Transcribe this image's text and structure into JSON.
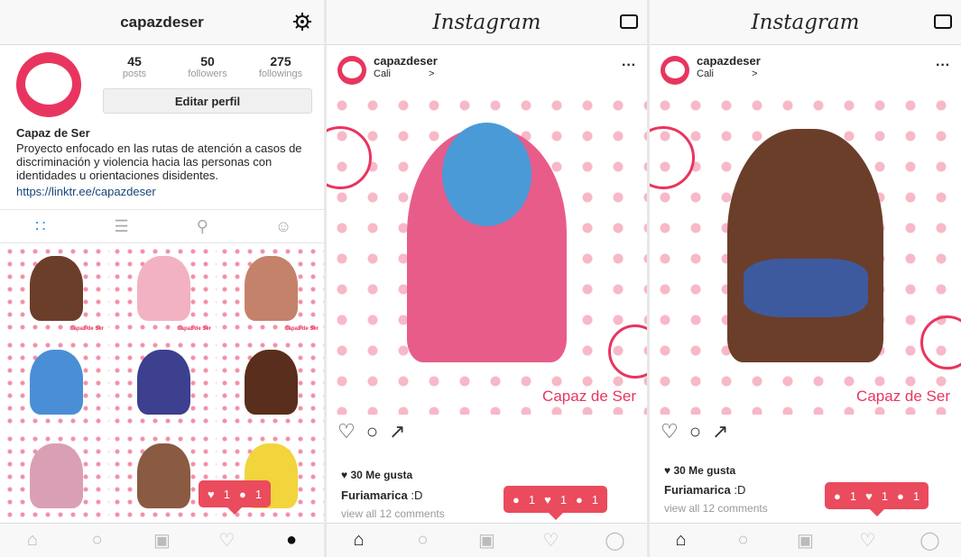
{
  "profile": {
    "username": "capazdeser",
    "posts": {
      "n": "45",
      "label": "posts"
    },
    "followers": {
      "n": "50",
      "label": "followers"
    },
    "followings": {
      "n": "275",
      "label": "followings"
    },
    "edit_label": "Editar perfil",
    "name": "Capaz de Ser",
    "bio": "Proyecto enfocado en las rutas de atención a casos de discriminación y violencia hacia las personas con identidades u orientaciones disidentes.",
    "link": "https://linktr.ee/capazdeser",
    "tile_caption": "Capaz de Ser",
    "notif": {
      "likes": "1",
      "followers": "1"
    }
  },
  "post1": {
    "logo": "Instagram",
    "user": "capazdeser",
    "location": "Cali",
    "loc_arrow": ">",
    "brand": "Capaz de Ser",
    "likes": "30 Me gusta",
    "comment_user": "Furiamarica",
    "comment_text": ":D",
    "view_all": "view all 12 comments",
    "notif": {
      "comments": "1",
      "likes": "1",
      "followers": "1"
    }
  },
  "post2": {
    "logo": "Instagram",
    "user": "capazdeser",
    "location": "Cali",
    "loc_arrow": ">",
    "brand": "Capaz de Ser",
    "likes": "30 Me gusta",
    "comment_user": "Furiamarica",
    "comment_text": ":D",
    "view_all": "view all 12 comments",
    "notif": {
      "comments": "1",
      "likes": "1",
      "followers": "1"
    }
  },
  "colors": {
    "brand": "#e8355f",
    "notif": "#ea4b5d",
    "link": "#16467a",
    "active_tab": "#3897f0"
  },
  "icons": [
    "gear-icon",
    "grid-icon",
    "list-icon",
    "location-pin-icon",
    "tagged-icon",
    "home-icon",
    "search-icon",
    "camera-icon",
    "heart-icon",
    "profile-icon",
    "inbox-icon",
    "more-icon",
    "comment-icon",
    "share-icon"
  ]
}
